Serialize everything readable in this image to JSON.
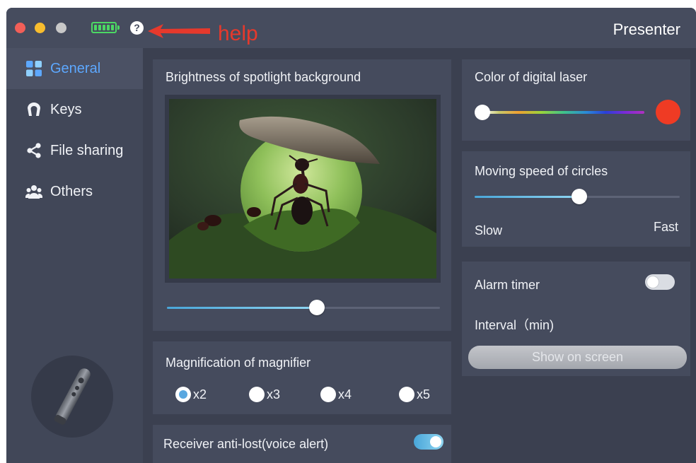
{
  "window": {
    "app_title": "Presenter",
    "annotation": "help",
    "help_glyph": "?",
    "battery_level": 1.0,
    "colors": {
      "background": "#3b4050",
      "titlebar": "#464c5e",
      "accent": "#5da8ff",
      "annotation": "#e6392c",
      "battery": "#4cd964"
    }
  },
  "sidebar": {
    "items": [
      {
        "label": "General",
        "icon": "grid-icon",
        "active": true
      },
      {
        "label": "Keys",
        "icon": "remote-keys-icon",
        "active": false
      },
      {
        "label": "File sharing",
        "icon": "share-icon",
        "active": false
      },
      {
        "label": "Others",
        "icon": "users-icon",
        "active": false
      }
    ],
    "device_image": "laser-pointer-remote"
  },
  "spotlight": {
    "title": "Brightness of spotlight background",
    "brightness": 0.55
  },
  "magnifier": {
    "title": "Magnification of magnifier",
    "options": [
      "x2",
      "x3",
      "x4",
      "x5"
    ],
    "selected": "x2"
  },
  "anti_lost": {
    "label": "Receiver anti-lost(voice alert)",
    "enabled": true
  },
  "laser": {
    "title": "Color of digital laser",
    "selected_color": "#ef3b24",
    "position": 0.0
  },
  "circles": {
    "title": "Moving speed of circles",
    "min_label": "Slow",
    "max_label": "Fast",
    "speed": 0.51
  },
  "alarm": {
    "title": "Alarm timer",
    "enabled": false,
    "interval_label": "Interval（min)",
    "show_button": "Show on screen"
  }
}
